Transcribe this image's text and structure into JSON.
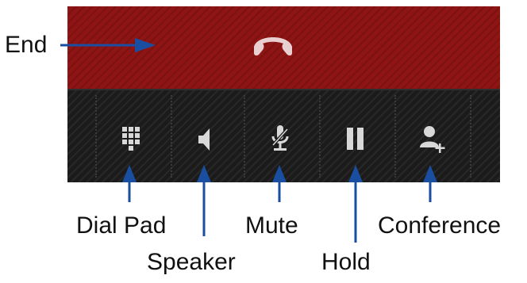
{
  "colors": {
    "end_bar": "#8f1414",
    "controls_bar": "#1b1b1b",
    "icon": "#d8d8d8",
    "arrow": "#1a4ea0"
  },
  "controls": [
    {
      "name": "dial-pad",
      "label": "Dial Pad",
      "icon": "dialpad-icon"
    },
    {
      "name": "speaker",
      "label": "Speaker",
      "icon": "speaker-icon"
    },
    {
      "name": "mute",
      "label": "Mute",
      "icon": "microphone-muted-icon"
    },
    {
      "name": "hold",
      "label": "Hold",
      "icon": "pause-icon"
    },
    {
      "name": "conference",
      "label": "Conference",
      "icon": "add-person-icon"
    }
  ],
  "end": {
    "label": "End",
    "icon": "hang-up-icon"
  }
}
